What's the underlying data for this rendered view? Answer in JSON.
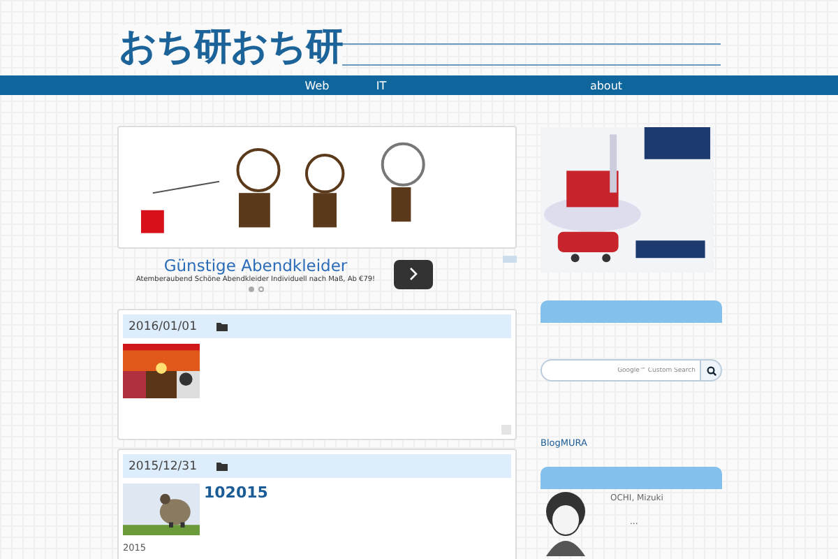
{
  "site_title": "おち研おち研",
  "nav": [
    {
      "label": "Web"
    },
    {
      "label": "IT"
    },
    {
      "label": "about"
    }
  ],
  "ad": {
    "headline": "Günstige Abendkleider",
    "text": "Atemberaubend Schöne Abendkleider Individuell nach Maß, Ab €79!",
    "dots": [
      {
        "selected": true
      },
      {
        "selected": false
      }
    ]
  },
  "posts": [
    {
      "date": "2016/01/01"
    },
    {
      "date": "2015/12/31",
      "title": "102015",
      "excerpt": "2015"
    }
  ],
  "sidebar": {
    "search": {
      "placeholder": "Google™ Custom Search"
    },
    "link": "BlogMURA",
    "profile": {
      "name": "OCHI, Mizuki",
      "bio": "..."
    }
  }
}
